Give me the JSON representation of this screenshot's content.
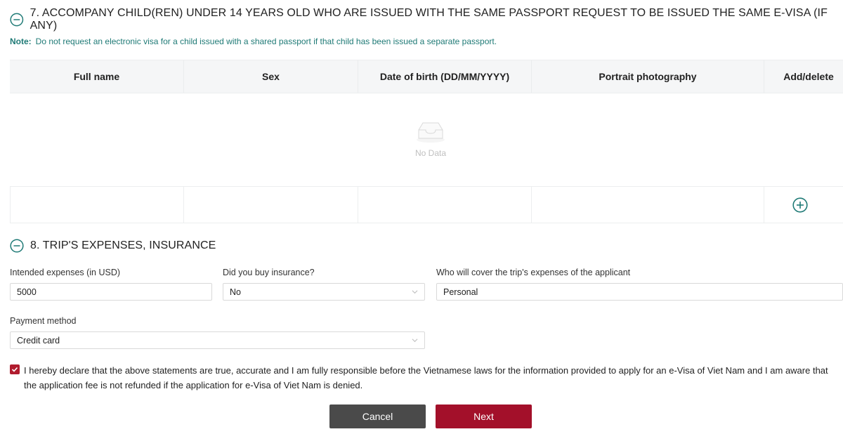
{
  "section7": {
    "title": "7. ACCOMPANY CHILD(REN) UNDER 14 YEARS OLD WHO ARE ISSUED WITH THE SAME PASSPORT REQUEST TO BE ISSUED THE SAME E-VISA (IF ANY)",
    "note_label": "Note:",
    "note_text": "Do not request an electronic visa for a child issued with a shared passport if that child has been issued a separate passport.",
    "table": {
      "columns": [
        "Full name",
        "Sex",
        "Date of birth (DD/MM/YYYY)",
        "Portrait photography",
        "Add/delete"
      ],
      "empty_text": "No Data"
    }
  },
  "section8": {
    "title": "8. TRIP'S EXPENSES, INSURANCE",
    "fields": {
      "expenses": {
        "label": "Intended expenses (in USD)",
        "value": "5000"
      },
      "insurance": {
        "label": "Did you buy insurance?",
        "value": "No"
      },
      "cover": {
        "label": "Who will cover the trip's expenses of the applicant",
        "value": "Personal"
      },
      "payment": {
        "label": "Payment method",
        "value": "Credit card"
      }
    }
  },
  "declaration": {
    "checked": true,
    "text": "I hereby declare that the above statements are true, accurate and I am fully responsible before the Vietnamese laws for the information provided to apply for an e-Visa of Viet Nam and I am aware that the application fee is not refunded if the application for e-Visa of Viet Nam is denied."
  },
  "buttons": {
    "cancel": "Cancel",
    "next": "Next"
  },
  "icons": {
    "collapse": "minus-circle-icon",
    "add": "plus-circle-icon",
    "empty": "empty-inbox-icon",
    "dropdown": "chevron-down-icon",
    "check": "checkmark-icon"
  },
  "colors": {
    "accent_teal": "#1f7a76",
    "primary_red": "#a3102a",
    "cancel_gray": "#4a4a4a",
    "checkbox_red": "#b01c2e"
  }
}
